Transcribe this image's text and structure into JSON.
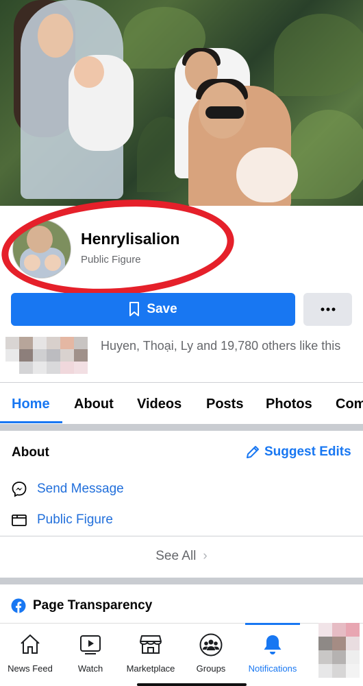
{
  "profile": {
    "name": "Henrylisalion",
    "category": "Public Figure"
  },
  "actions": {
    "save_label": "Save",
    "more_label": "•••"
  },
  "likes": {
    "text": "Huyen, Thoại, Ly and 19,780 others like this"
  },
  "tabs": [
    {
      "label": "Home",
      "active": true
    },
    {
      "label": "About"
    },
    {
      "label": "Videos"
    },
    {
      "label": "Posts"
    },
    {
      "label": "Photos"
    },
    {
      "label": "Com"
    }
  ],
  "about": {
    "heading": "About",
    "suggest_edits": "Suggest Edits",
    "rows": [
      {
        "icon": "messenger-icon",
        "label": "Send Message"
      },
      {
        "icon": "category-icon",
        "label": "Public Figure"
      }
    ],
    "see_all": "See All"
  },
  "transparency": {
    "heading": "Page Transparency"
  },
  "bottom_nav": [
    {
      "label": "News Feed",
      "icon": "home-icon"
    },
    {
      "label": "Watch",
      "icon": "watch-icon"
    },
    {
      "label": "Marketplace",
      "icon": "marketplace-icon"
    },
    {
      "label": "Groups",
      "icon": "groups-icon"
    },
    {
      "label": "Notifications",
      "icon": "bell-icon",
      "active": true
    }
  ],
  "colors": {
    "accent": "#1877f2",
    "annotation_ring": "#e5202a",
    "secondary_text": "#65676b"
  }
}
